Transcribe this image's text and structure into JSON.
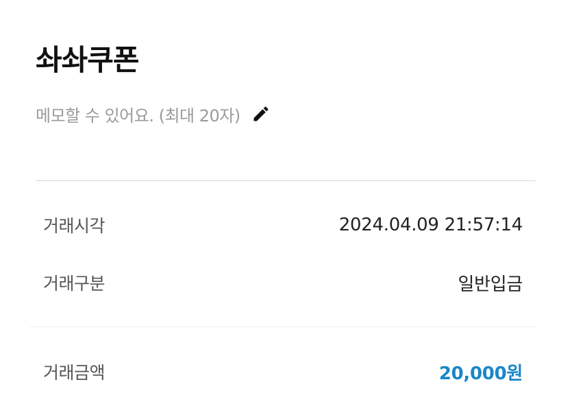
{
  "header": {
    "title": "솨솨쿠폰",
    "memo_placeholder": "메모할 수 있어요. (최대 20자)",
    "edit_icon": "pencil-icon"
  },
  "details": {
    "time": {
      "label": "거래시각",
      "value": "2024.04.09 21:57:14"
    },
    "type": {
      "label": "거래구분",
      "value": "일반입금"
    },
    "amount": {
      "label": "거래금액",
      "value": "20,000원"
    }
  },
  "colors": {
    "amount_accent": "#1a86c8",
    "memo_gray": "#9a9a9a"
  }
}
